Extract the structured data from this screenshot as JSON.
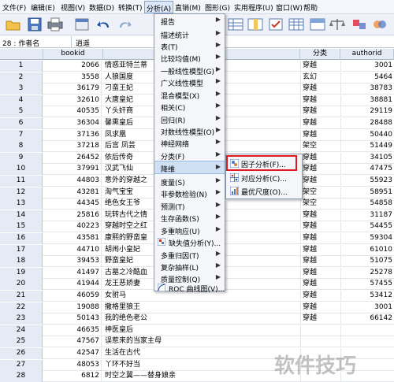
{
  "menubar": {
    "items": [
      "文件(F)",
      "编辑(E)",
      "视图(V)",
      "数据(D)",
      "转换(T)",
      "分析(A)",
      "直销(M)",
      "图形(G)",
      "实用程序(U)",
      "窗口(W)",
      "帮助"
    ],
    "active_index": 5
  },
  "toolbar": {
    "icons": [
      "open-folder-icon",
      "save-icon",
      "print-icon",
      "dialog-recall-icon",
      "undo-icon",
      "redo-icon",
      "goto-case-icon",
      "goto-variable-icon",
      "variables-icon",
      "find-icon",
      "insert-cases-icon",
      "split-file-icon",
      "weight-cases-icon",
      "select-cases-icon",
      "value-labels-icon",
      "use-sets-icon",
      "spell-icon"
    ]
  },
  "cellbar": {
    "ref": "28 : 作者名",
    "value": "逍遥"
  },
  "grid": {
    "columns": {
      "rownum": "",
      "bookid": "bookid",
      "title": "",
      "category": "分类",
      "author": "authorid"
    },
    "rows": [
      {
        "n": "1",
        "bookid": "2066",
        "title": "情惑亚特兰蒂",
        "category": "穿越",
        "author": "3001"
      },
      {
        "n": "2",
        "bookid": "3558",
        "title": "人狼国度",
        "category": "玄幻",
        "author": "5464"
      },
      {
        "n": "3",
        "bookid": "36179",
        "title": "刁蛮王妃",
        "category": "穿越",
        "author": "38783"
      },
      {
        "n": "4",
        "bookid": "32610",
        "title": "大唐皇妃",
        "category": "穿越",
        "author": "38881"
      },
      {
        "n": "5",
        "bookid": "40535",
        "title": "丫头奸商",
        "category": "穿越",
        "author": "29119"
      },
      {
        "n": "6",
        "bookid": "36304",
        "title": "馨熏皇后",
        "category": "穿越",
        "author": "28488"
      },
      {
        "n": "7",
        "bookid": "37136",
        "title": "凤求凰",
        "category": "穿越",
        "author": "50440"
      },
      {
        "n": "8",
        "bookid": "37218",
        "title": "后宫 凤芸",
        "category": "架空",
        "author": "51449"
      },
      {
        "n": "9",
        "bookid": "26452",
        "title": "依后传奇",
        "category": "穿越",
        "author": "34105"
      },
      {
        "n": "10",
        "bookid": "37991",
        "title": "汉武飞仙",
        "category": "穿越",
        "author": "47475"
      },
      {
        "n": "11",
        "bookid": "44803",
        "title": "意外的穿越之",
        "category": "穿越",
        "author": "55923"
      },
      {
        "n": "12",
        "bookid": "43281",
        "title": "淘气宝宝",
        "category": "架空",
        "author": "58951"
      },
      {
        "n": "13",
        "bookid": "44345",
        "title": "绝色女王爷",
        "category": "架空",
        "author": "54858"
      },
      {
        "n": "14",
        "bookid": "25816",
        "title": "玩转古代之情",
        "category": "穿越",
        "author": "31187"
      },
      {
        "n": "15",
        "bookid": "40223",
        "title": "穿越时空之红",
        "category": "穿越",
        "author": "54455"
      },
      {
        "n": "16",
        "bookid": "43581",
        "title": "康熙的野蛮皇",
        "category": "穿越",
        "author": "59304"
      },
      {
        "n": "17",
        "bookid": "44710",
        "title": "胡闹小皇妃",
        "category": "穿越",
        "author": "61010"
      },
      {
        "n": "18",
        "bookid": "39453",
        "title": "野蛮皇妃",
        "category": "穿越",
        "author": "51075"
      },
      {
        "n": "19",
        "bookid": "41497",
        "title": "古墓之冷酷血",
        "category": "穿越",
        "author": "25278"
      },
      {
        "n": "20",
        "bookid": "41944",
        "title": "龙王恶娇妻",
        "category": "穿越",
        "author": "57455"
      },
      {
        "n": "21",
        "bookid": "46059",
        "title": "女驸马",
        "category": "穿越",
        "author": "53412"
      },
      {
        "n": "22",
        "bookid": "19088",
        "title": "撒格里狼王",
        "category": "穿越",
        "author": "3001"
      },
      {
        "n": "23",
        "bookid": "50143",
        "title": "我的绝色老公",
        "category": "穿越",
        "author": "66142"
      },
      {
        "n": "24",
        "bookid": "46635",
        "title": "神医皇后",
        "category": "",
        "author": ""
      },
      {
        "n": "25",
        "bookid": "47567",
        "title": "误惹来的当家主母",
        "category": "",
        "author": ""
      },
      {
        "n": "26",
        "bookid": "42547",
        "title": "生活在古代",
        "category": "",
        "author": ""
      },
      {
        "n": "27",
        "bookid": "48053",
        "title": "丫环不好当",
        "category": "",
        "author": ""
      },
      {
        "n": "28",
        "bookid": "6812",
        "title": "时空之翼——替身娘亲",
        "category": "",
        "author": ""
      }
    ]
  },
  "analyze_menu": {
    "items": [
      {
        "label": "报告",
        "arrow": true
      },
      {
        "label": "描述统计",
        "arrow": true
      },
      {
        "label": "表(T)",
        "arrow": true
      },
      {
        "label": "比较均值(M)",
        "arrow": true
      },
      {
        "label": "一般线性模型(G)",
        "arrow": true
      },
      {
        "label": "广义线性模型",
        "arrow": true
      },
      {
        "label": "混合模型(X)",
        "arrow": true
      },
      {
        "label": "相关(C)",
        "arrow": true
      },
      {
        "label": "回归(R)",
        "arrow": true
      },
      {
        "label": "对数线性模型(O)",
        "arrow": true
      },
      {
        "label": "神经网络",
        "arrow": true
      },
      {
        "label": "分类(F)",
        "arrow": true
      },
      {
        "label": "降维",
        "arrow": true,
        "highlighted": true
      },
      {
        "label": "度量(S)",
        "arrow": true
      },
      {
        "label": "非参数检验(N)",
        "arrow": true
      },
      {
        "label": "预测(T)",
        "arrow": true
      },
      {
        "label": "生存函数(S)",
        "arrow": true
      },
      {
        "label": "多重响应(U)",
        "arrow": true
      },
      {
        "label": "缺失值分析(Y)...",
        "arrow": false,
        "icon": "missing-value-icon"
      },
      {
        "label": "多重归因(T)",
        "arrow": true
      },
      {
        "label": "复杂抽样(L)",
        "arrow": true
      },
      {
        "label": "质量控制(Q)",
        "arrow": true
      },
      {
        "label": "ROC 曲线图(V)...",
        "arrow": false,
        "icon": "roc-curve-icon"
      }
    ]
  },
  "reduce_submenu": {
    "items": [
      {
        "label": "因子分析(F)...",
        "icon": "factor-analysis-icon"
      },
      {
        "label": "对应分析(C)...",
        "icon": "correspondence-icon"
      },
      {
        "label": "最优尺度(O)...",
        "icon": "optimal-scaling-icon"
      }
    ]
  },
  "watermark": "软件技巧",
  "colors": {
    "menu_highlight": "#cfe0f5",
    "red_box": "#e0191f",
    "header_bg": "#e4ebf5"
  }
}
